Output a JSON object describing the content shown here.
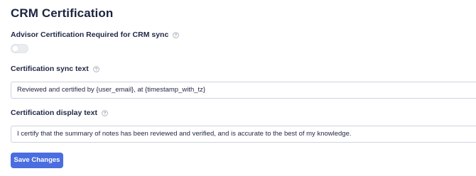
{
  "page": {
    "title": "CRM Certification"
  },
  "certification_required": {
    "label": "Advisor Certification Required for CRM sync",
    "help_icon": "question-circle-icon",
    "enabled": false
  },
  "sync_text": {
    "label": "Certification sync text",
    "help_icon": "question-circle-icon",
    "value": "Reviewed and certified by {user_email}, at {timestamp_with_tz}"
  },
  "display_text": {
    "label": "Certification display text",
    "help_icon": "question-circle-icon",
    "value": "I certify that the summary of notes has been reviewed and verified, and is accurate to the best of my knowledge."
  },
  "actions": {
    "save_label": "Save Changes"
  },
  "colors": {
    "primary": "#4a6ee0",
    "text": "#1c2340",
    "toggle_off": "#e9ecf1",
    "border": "#cfd4dc"
  }
}
